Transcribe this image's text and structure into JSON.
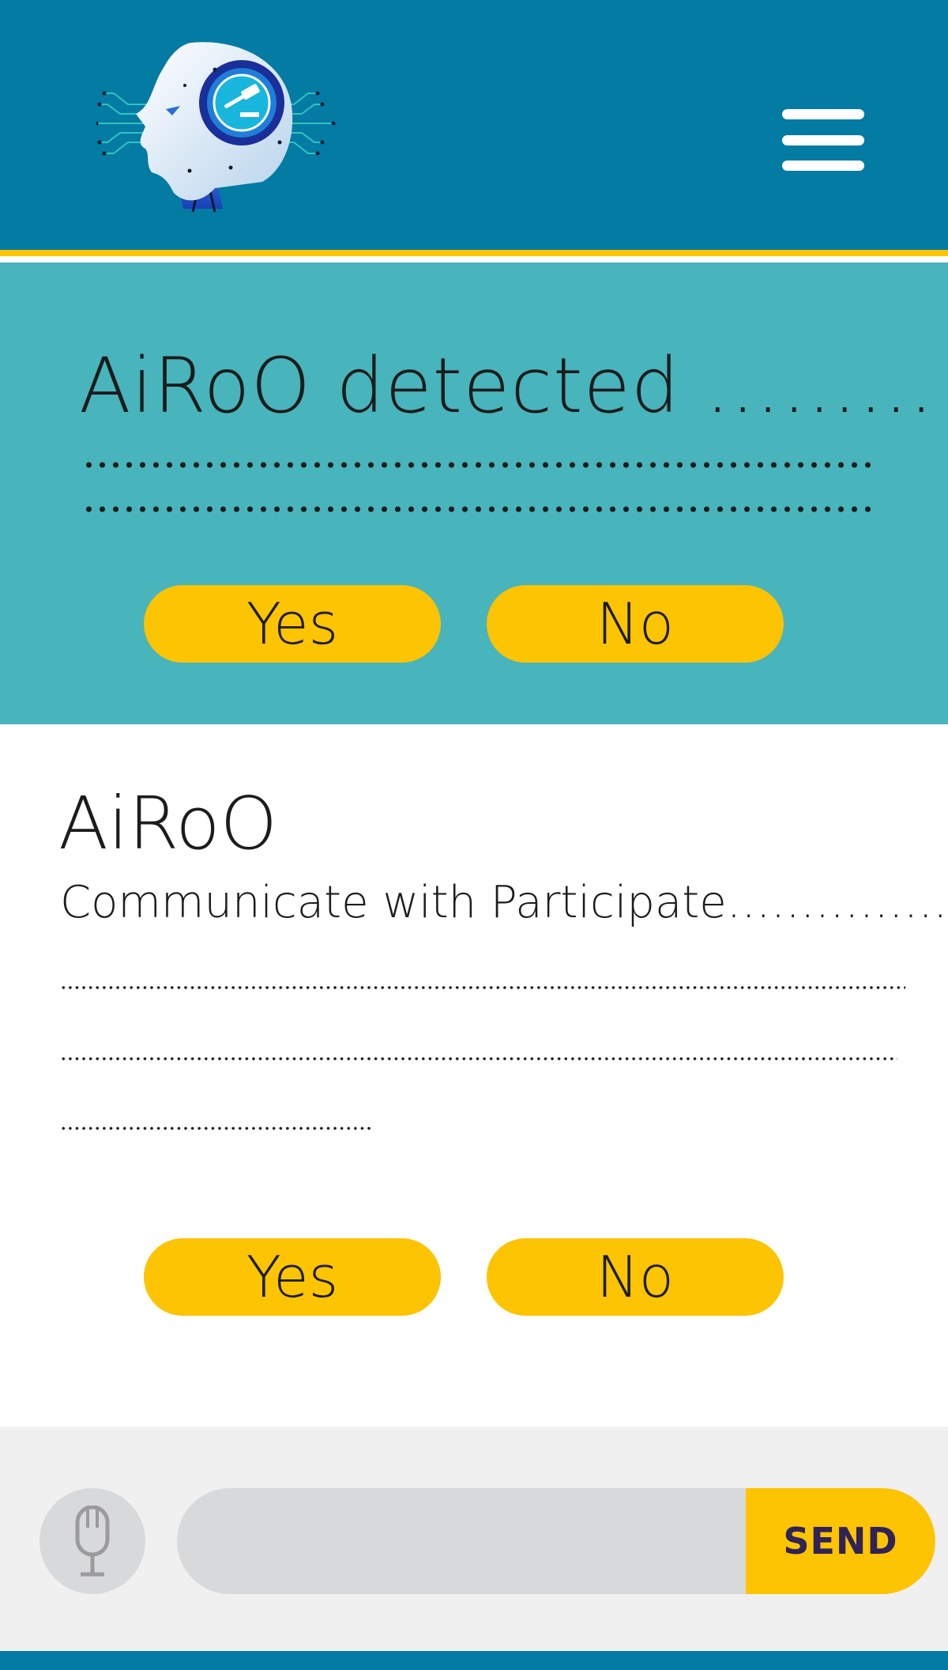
{
  "header": {
    "logo_icon": "robot-head-gavel-logo",
    "menu_icon": "hamburger-menu-icon"
  },
  "alert": {
    "title": "AiRoO detected ………",
    "yes_label": "Yes",
    "no_label": "No"
  },
  "message": {
    "sender": "AiRoO",
    "text": "Communicate with Participate……………",
    "yes_label": "Yes",
    "no_label": "No"
  },
  "composer": {
    "mic_icon": "microphone-icon",
    "input_value": "",
    "input_placeholder": "",
    "send_label": "SEND"
  },
  "colors": {
    "header_bg": "#037ba3",
    "accent_yellow": "#fcc403",
    "alert_bg": "#48b4bc",
    "send_text": "#2f2357"
  }
}
